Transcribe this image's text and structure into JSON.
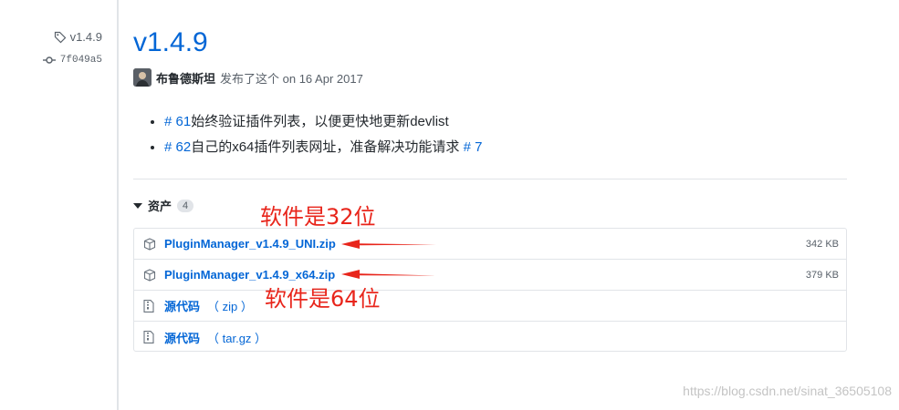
{
  "sidebar": {
    "tag": "v1.4.9",
    "commit": "7f049a5"
  },
  "release": {
    "title": "v1.4.9",
    "author": "布鲁德斯坦",
    "published": "发布了这个 on 16 Apr 2017",
    "notes": [
      {
        "ref": "# 61",
        "text": "始终验证插件列表，以便更快地更新devlist",
        "ref2": ""
      },
      {
        "ref": "# 62",
        "text": "自己的x64插件列表网址，准备解决功能请求",
        "ref2": "# 7"
      }
    ]
  },
  "assets": {
    "label": "资产",
    "count": "4",
    "items": [
      {
        "name": "PluginManager_v1.4.9_UNI.zip",
        "size": "342 KB",
        "icon": "package-icon"
      },
      {
        "name": "PluginManager_v1.4.9_x64.zip",
        "size": "379 KB",
        "icon": "package-icon"
      },
      {
        "name": "源代码",
        "suffix": "（ zip ）",
        "icon": "file-zip-icon"
      },
      {
        "name": "源代码",
        "suffix": "（ tar.gz ）",
        "icon": "file-zip-icon"
      }
    ]
  },
  "annotations": {
    "label_32": "软件是32位",
    "label_64": "软件是64位",
    "color": "#e8251b"
  },
  "watermark": "https://blog.csdn.net/sinat_36505108"
}
